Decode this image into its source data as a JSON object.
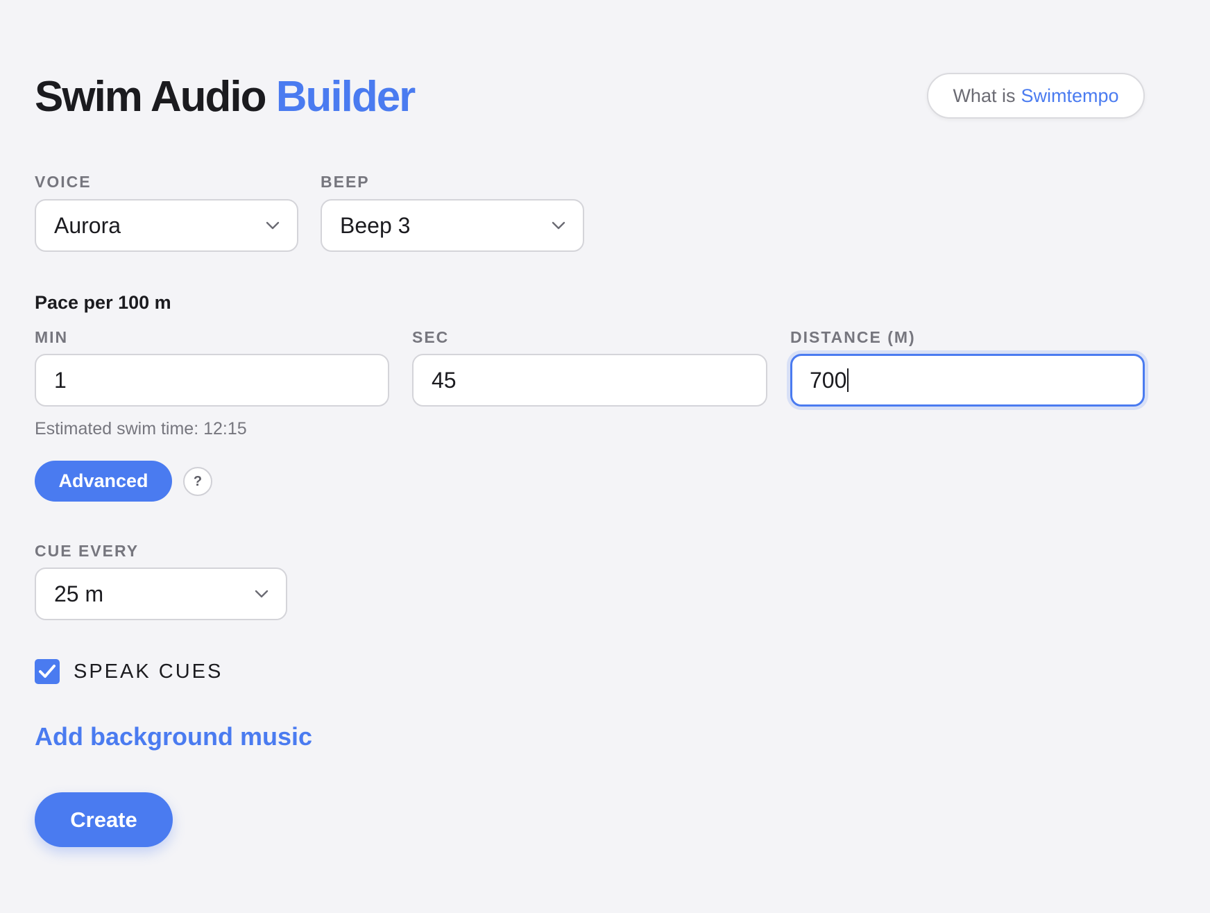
{
  "header": {
    "title_main": "Swim Audio",
    "title_accent": "Builder",
    "about_prefix": "What is",
    "about_brand": "Swimtempo"
  },
  "voice": {
    "label": "VOICE",
    "value": "Aurora"
  },
  "beep": {
    "label": "BEEP",
    "value": "Beep 3"
  },
  "pace": {
    "heading": "Pace per 100 m",
    "min_label": "MIN",
    "min_value": "1",
    "sec_label": "SEC",
    "sec_value": "45",
    "distance_label": "DISTANCE (M)",
    "distance_value": "700",
    "estimate": "Estimated swim time: 12:15"
  },
  "advanced": {
    "button_label": "Advanced",
    "help_label": "?"
  },
  "cue": {
    "label": "CUE EVERY",
    "value": "25 m"
  },
  "speak_cues": {
    "label": "SPEAK CUES",
    "checked": true
  },
  "music": {
    "link_label": "Add background music"
  },
  "create": {
    "button_label": "Create"
  },
  "colors": {
    "accent": "#4a7bf0",
    "background": "#f4f4f7",
    "muted_text": "#76767e"
  },
  "icons": {
    "select_chevron": "chevron-down-icon",
    "checkbox_mark": "check-icon"
  }
}
